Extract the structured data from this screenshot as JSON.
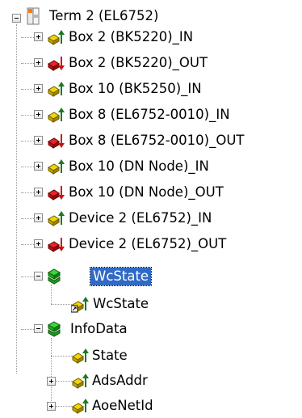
{
  "tree": {
    "root": {
      "label": "Term 2 (EL6752)",
      "icon": "terminal-icon"
    },
    "children": [
      {
        "label": "Box 2 (BK5220)_IN",
        "icon": "input-variable-icon"
      },
      {
        "label": "Box 2 (BK5220)_OUT",
        "icon": "output-variable-icon"
      },
      {
        "label": "Box 10 (BK5250)_IN",
        "icon": "input-variable-icon"
      },
      {
        "label": "Box 8 (EL6752-0010)_IN",
        "icon": "input-variable-icon"
      },
      {
        "label": "Box 8 (EL6752-0010)_OUT",
        "icon": "output-variable-icon"
      },
      {
        "label": "Box 10 (DN Node)_IN",
        "icon": "input-variable-icon"
      },
      {
        "label": "Box 10 (DN Node)_OUT",
        "icon": "output-variable-icon"
      },
      {
        "label": "Device 2 (EL6752)_IN",
        "icon": "input-variable-icon"
      },
      {
        "label": "Device 2 (EL6752)_OUT",
        "icon": "output-variable-icon"
      },
      {
        "label": "WcState",
        "icon": "status-group-icon",
        "selected": true,
        "children": [
          {
            "label": "WcState",
            "icon": "linked-input-variable-icon"
          }
        ]
      },
      {
        "label": "InfoData",
        "icon": "status-group-icon",
        "children": [
          {
            "label": "State",
            "icon": "input-variable-icon"
          },
          {
            "label": "AdsAddr",
            "icon": "input-variable-icon"
          },
          {
            "label": "AoeNetId",
            "icon": "input-variable-icon"
          }
        ]
      }
    ]
  },
  "colors": {
    "selection": "#316ac5",
    "input_arrow": "#1e7a1e",
    "output_arrow": "#d01010",
    "variable_box": "#e8c800"
  }
}
